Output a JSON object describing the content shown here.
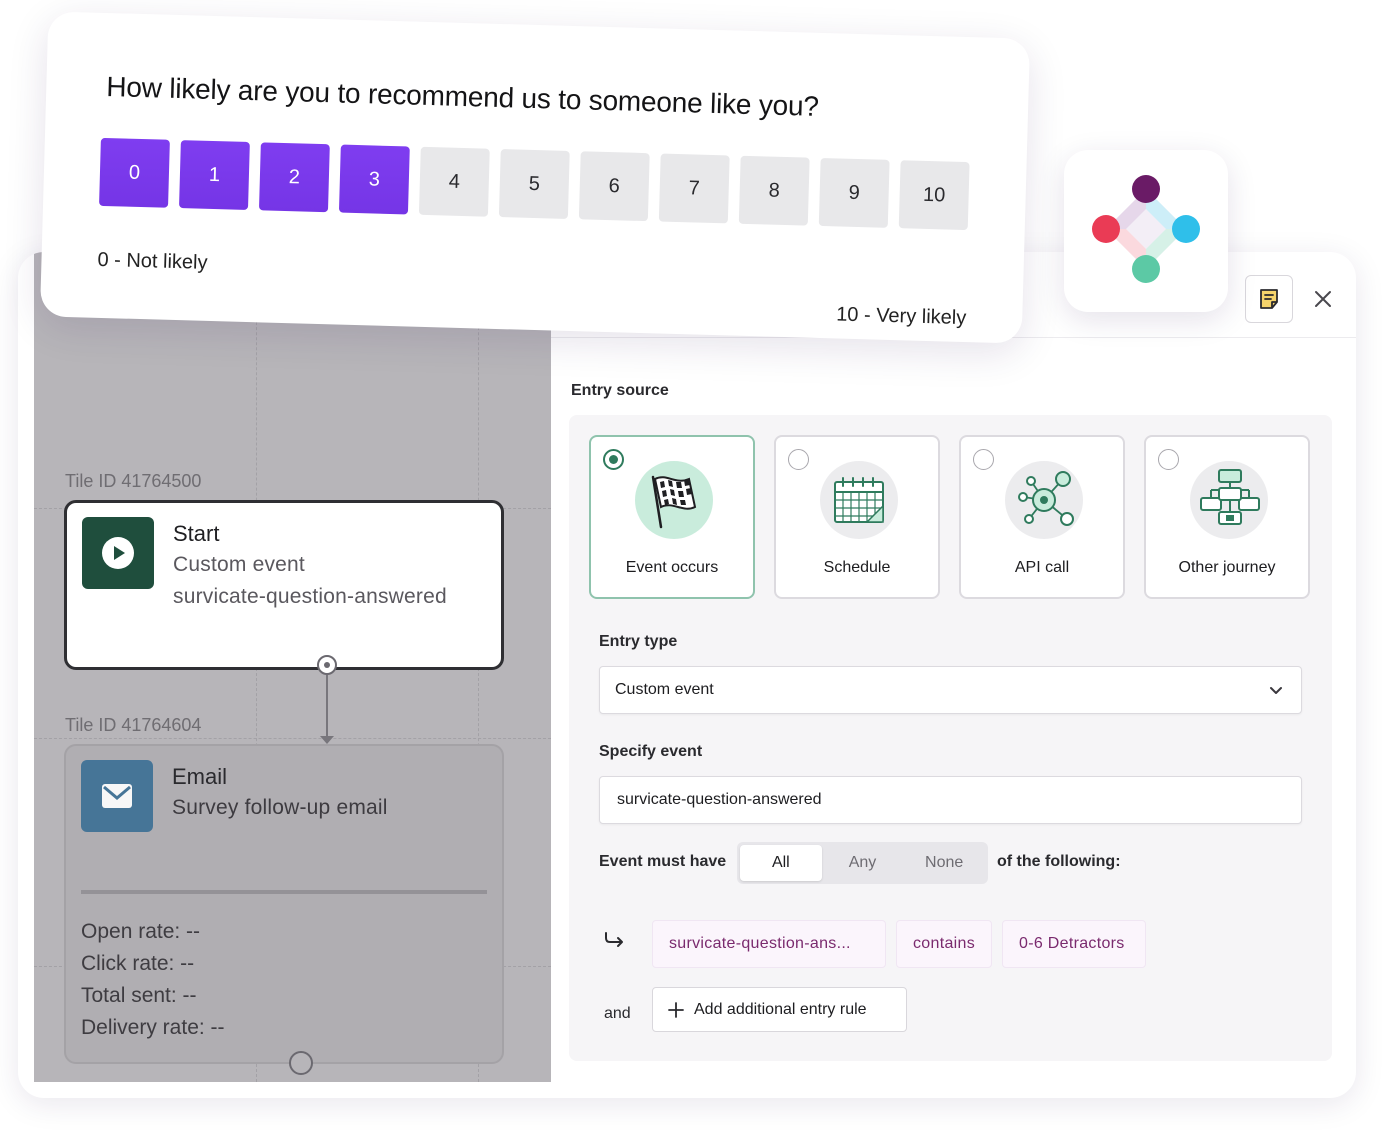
{
  "survey": {
    "question": "How likely are you to recommend us to someone like you?",
    "scale": [
      "0",
      "1",
      "2",
      "3",
      "4",
      "5",
      "6",
      "7",
      "8",
      "9",
      "10"
    ],
    "selected_max": 3,
    "low_label": "0 - Not likely",
    "high_label": "10 - Very likely",
    "accent_color": "#7c3aed"
  },
  "canvas": {
    "start_tile": {
      "id_label": "Tile ID 41764500",
      "title": "Start",
      "subtitle": "Custom event",
      "detail": "survicate-question-answered",
      "icon": "play-icon"
    },
    "email_tile": {
      "id_label": "Tile ID 41764604",
      "title": "Email",
      "subtitle": "Survey follow-up email",
      "icon": "envelope-icon",
      "stats": [
        "Open rate:  --",
        "Click rate:  --",
        "Total sent:  --",
        "Delivery rate:  --"
      ]
    }
  },
  "panel": {
    "entry_source_label": "Entry source",
    "sources": [
      {
        "label": "Event occurs",
        "selected": true,
        "icon": "checkered-flag-icon"
      },
      {
        "label": "Schedule",
        "selected": false,
        "icon": "calendar-icon"
      },
      {
        "label": "API call",
        "selected": false,
        "icon": "network-icon"
      },
      {
        "label": "Other journey",
        "selected": false,
        "icon": "flowchart-icon"
      }
    ],
    "entry_type_label": "Entry type",
    "entry_type_value": "Custom event",
    "specify_event_label": "Specify event",
    "specify_event_value": "survicate-question-answered",
    "event_must_have_label": "Event must have",
    "match_options": [
      "All",
      "Any",
      "None"
    ],
    "match_selected": "All",
    "of_following_label": "of the following:",
    "rule": {
      "property": "survicate-question-ans...",
      "operator": "contains",
      "value": "0-6 Detractors"
    },
    "and_label": "and",
    "add_rule_label": "Add additional entry rule"
  }
}
